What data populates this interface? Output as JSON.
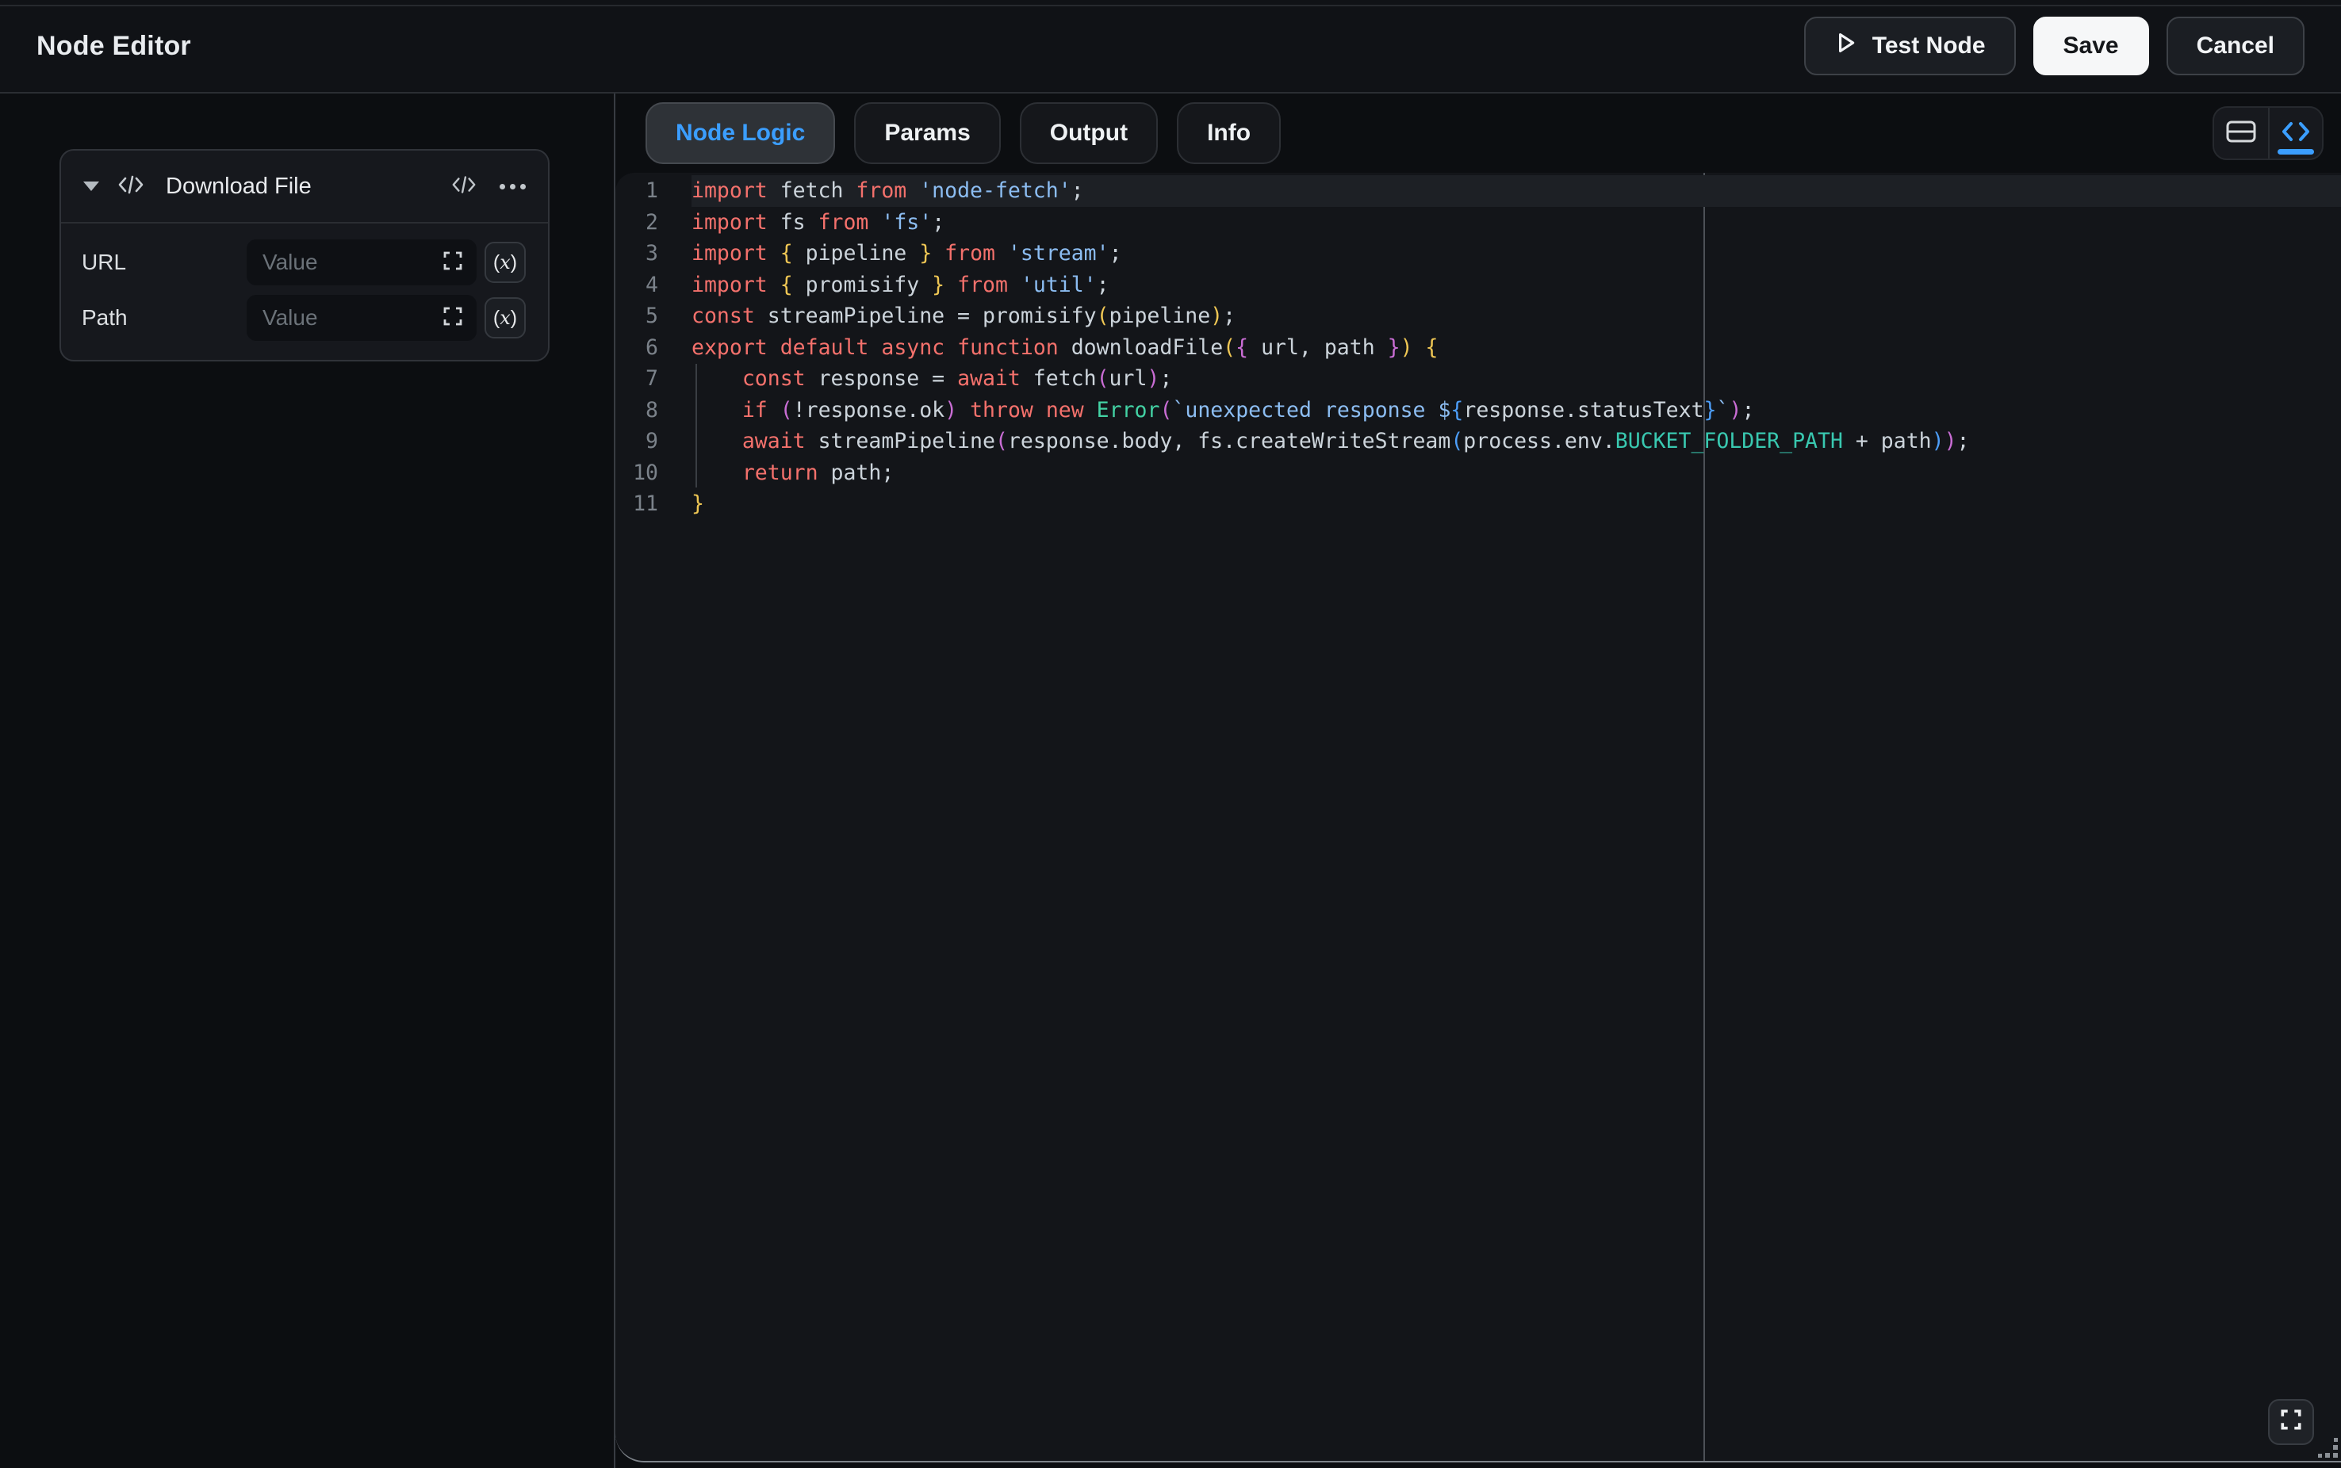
{
  "header": {
    "title": "Node Editor",
    "test_button": "Test Node",
    "save_button": "Save",
    "cancel_button": "Cancel"
  },
  "node_card": {
    "title": "Download File",
    "icons": [
      "chevron-down-icon",
      "code-icon",
      "code-icon",
      "ellipsis-icon"
    ],
    "fields": [
      {
        "label": "URL",
        "value": "",
        "placeholder": "Value",
        "buttons": [
          "expand-icon",
          "fx-variable-button"
        ]
      },
      {
        "label": "Path",
        "value": "",
        "placeholder": "Value",
        "buttons": [
          "expand-icon",
          "fx-variable-button"
        ]
      }
    ],
    "fx_button_label": "(x)"
  },
  "tabs": {
    "items": [
      {
        "label": "Node Logic",
        "active": true
      },
      {
        "label": "Params",
        "active": false
      },
      {
        "label": "Output",
        "active": false
      },
      {
        "label": "Info",
        "active": false
      }
    ]
  },
  "view_toggle": {
    "segments": [
      {
        "icon": "split-rows-icon",
        "active": false
      },
      {
        "icon": "code-icon",
        "active": true
      }
    ]
  },
  "editor": {
    "language": "javascript",
    "active_line": 1,
    "ruler_column": 80,
    "lines": [
      {
        "n": 1,
        "tokens": [
          [
            "kw",
            "import"
          ],
          [
            "txt",
            " fetch "
          ],
          [
            "kw",
            "from"
          ],
          [
            "txt",
            " "
          ],
          [
            "str",
            "'node-fetch'"
          ],
          [
            "txt",
            ";"
          ]
        ]
      },
      {
        "n": 2,
        "tokens": [
          [
            "kw",
            "import"
          ],
          [
            "txt",
            " fs "
          ],
          [
            "kw",
            "from"
          ],
          [
            "txt",
            " "
          ],
          [
            "str",
            "'fs'"
          ],
          [
            "txt",
            ";"
          ]
        ]
      },
      {
        "n": 3,
        "tokens": [
          [
            "kw",
            "import"
          ],
          [
            "txt",
            " "
          ],
          [
            "b1",
            "{"
          ],
          [
            "txt",
            " pipeline "
          ],
          [
            "b1",
            "}"
          ],
          [
            "txt",
            " "
          ],
          [
            "kw",
            "from"
          ],
          [
            "txt",
            " "
          ],
          [
            "str",
            "'stream'"
          ],
          [
            "txt",
            ";"
          ]
        ]
      },
      {
        "n": 4,
        "tokens": [
          [
            "kw",
            "import"
          ],
          [
            "txt",
            " "
          ],
          [
            "b1",
            "{"
          ],
          [
            "txt",
            " promisify "
          ],
          [
            "b1",
            "}"
          ],
          [
            "txt",
            " "
          ],
          [
            "kw",
            "from"
          ],
          [
            "txt",
            " "
          ],
          [
            "str",
            "'util'"
          ],
          [
            "txt",
            ";"
          ]
        ]
      },
      {
        "n": 5,
        "tokens": [
          [
            "kw",
            "const"
          ],
          [
            "txt",
            " streamPipeline = promisify"
          ],
          [
            "b1",
            "("
          ],
          [
            "txt",
            "pipeline"
          ],
          [
            "b1",
            ")"
          ],
          [
            "txt",
            ";"
          ]
        ]
      },
      {
        "n": 6,
        "tokens": [
          [
            "kw",
            "export"
          ],
          [
            "txt",
            " "
          ],
          [
            "kw",
            "default"
          ],
          [
            "txt",
            " "
          ],
          [
            "kw",
            "async"
          ],
          [
            "txt",
            " "
          ],
          [
            "kw",
            "function"
          ],
          [
            "txt",
            " downloadFile"
          ],
          [
            "b1",
            "("
          ],
          [
            "b2",
            "{"
          ],
          [
            "txt",
            " url, path "
          ],
          [
            "b2",
            "}"
          ],
          [
            "b1",
            ")"
          ],
          [
            "txt",
            " "
          ],
          [
            "b1",
            "{"
          ]
        ]
      },
      {
        "n": 7,
        "tokens": [
          [
            "txt",
            "    "
          ],
          [
            "kw",
            "const"
          ],
          [
            "txt",
            " response = "
          ],
          [
            "kw",
            "await"
          ],
          [
            "txt",
            " fetch"
          ],
          [
            "b2",
            "("
          ],
          [
            "txt",
            "url"
          ],
          [
            "b2",
            ")"
          ],
          [
            "txt",
            ";"
          ]
        ]
      },
      {
        "n": 8,
        "tokens": [
          [
            "txt",
            "    "
          ],
          [
            "kw",
            "if"
          ],
          [
            "txt",
            " "
          ],
          [
            "b2",
            "("
          ],
          [
            "txt",
            "!response.ok"
          ],
          [
            "b2",
            ")"
          ],
          [
            "txt",
            " "
          ],
          [
            "kw",
            "throw"
          ],
          [
            "txt",
            " "
          ],
          [
            "kw",
            "new"
          ],
          [
            "txt",
            " "
          ],
          [
            "cls",
            "Error"
          ],
          [
            "b2",
            "("
          ],
          [
            "str",
            "`unexpected response $"
          ],
          [
            "b3",
            "{"
          ],
          [
            "txt",
            "response.statusText"
          ],
          [
            "b3",
            "}"
          ],
          [
            "str",
            "`"
          ],
          [
            "b2",
            ")"
          ],
          [
            "txt",
            ";"
          ]
        ]
      },
      {
        "n": 9,
        "tokens": [
          [
            "txt",
            "    "
          ],
          [
            "kw",
            "await"
          ],
          [
            "txt",
            " streamPipeline"
          ],
          [
            "b2",
            "("
          ],
          [
            "txt",
            "response.body, fs.createWriteStream"
          ],
          [
            "b3",
            "("
          ],
          [
            "txt",
            "process.env."
          ],
          [
            "env",
            "BUCKET_FOLDER_PATH"
          ],
          [
            "txt",
            " + path"
          ],
          [
            "b3",
            ")"
          ],
          [
            "b2",
            ")"
          ],
          [
            "txt",
            ";"
          ]
        ]
      },
      {
        "n": 10,
        "tokens": [
          [
            "txt",
            "    "
          ],
          [
            "kw",
            "return"
          ],
          [
            "txt",
            " path;"
          ]
        ]
      },
      {
        "n": 11,
        "tokens": [
          [
            "b1",
            "}"
          ]
        ]
      }
    ]
  },
  "colors": {
    "accent_blue": "#3b9eff",
    "keyword": "#f4716c",
    "string": "#8cbdf2",
    "bracket_level1": "#eec654",
    "bracket_level2": "#c96dd4",
    "bracket_level3": "#4d9ef9",
    "class_name": "#43d2a4",
    "env_constant": "#39c8b0",
    "plain_text": "#ccd4db"
  }
}
